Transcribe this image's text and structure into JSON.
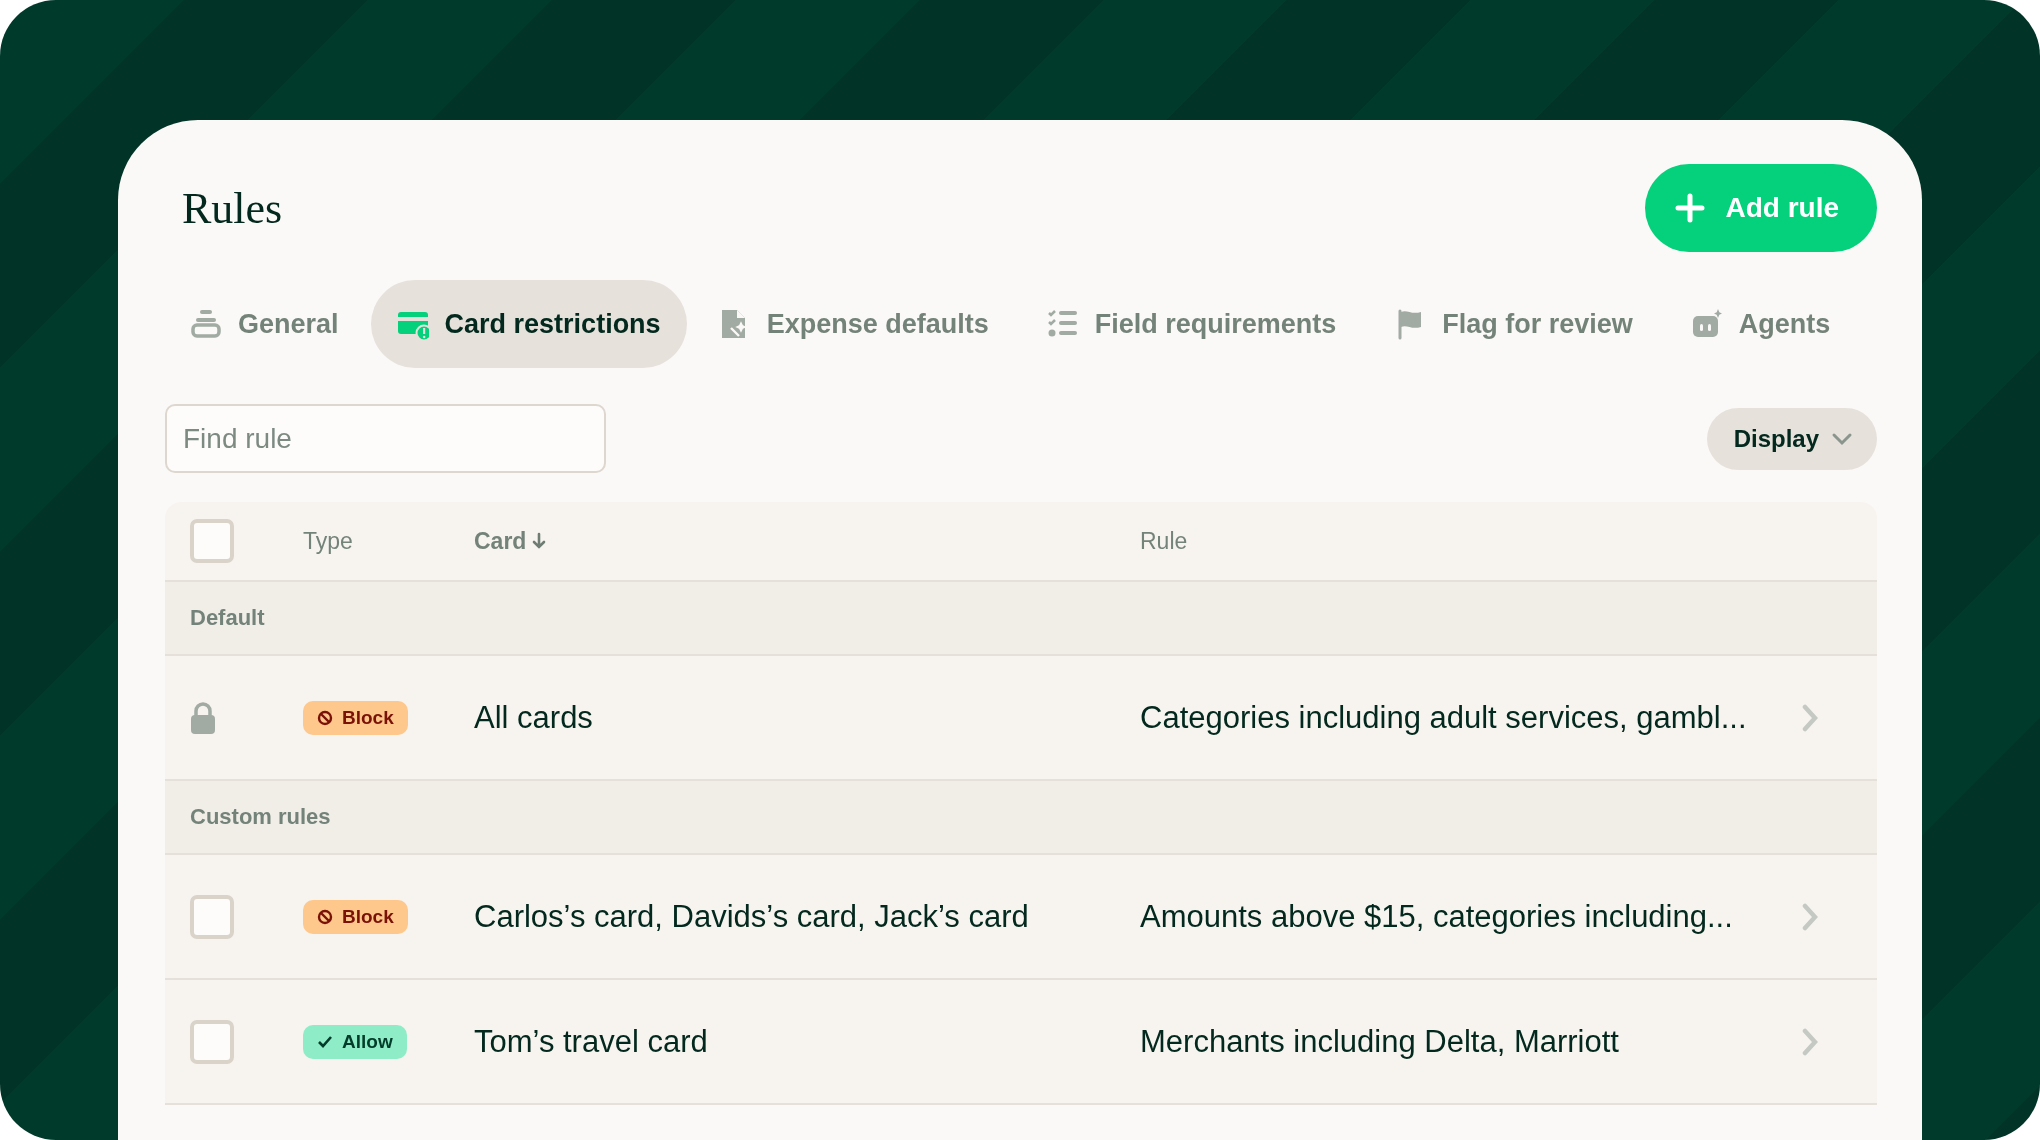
{
  "page": {
    "title": "Rules"
  },
  "add_button": {
    "label": "Add rule"
  },
  "tabs": [
    {
      "label": "General",
      "kind": "general",
      "selected": false
    },
    {
      "label": "Card restrictions",
      "kind": "card",
      "selected": true
    },
    {
      "label": "Expense defaults",
      "kind": "document",
      "selected": false
    },
    {
      "label": "Field requirements",
      "kind": "checklist",
      "selected": false
    },
    {
      "label": "Flag for review",
      "kind": "flag",
      "selected": false
    },
    {
      "label": "Agents",
      "kind": "robot",
      "selected": false
    }
  ],
  "search": {
    "placeholder": "Find rule"
  },
  "display_button": {
    "label": "Display"
  },
  "table": {
    "select_all": {
      "checked": false
    },
    "columns": [
      {
        "label": "Type",
        "sorted": false
      },
      {
        "label": "Card",
        "sorted": true
      },
      {
        "label": "Rule",
        "sorted": false
      }
    ],
    "groups": [
      {
        "label": "Default",
        "rows": [
          {
            "kind": "locked",
            "type": {
              "kind": "block",
              "label": "Block"
            },
            "card": "All cards",
            "rule": "Categories including adult services, gambl..."
          }
        ]
      },
      {
        "label": "Custom rules",
        "rows": [
          {
            "kind": "selectable",
            "checked": false,
            "type": {
              "kind": "block",
              "label": "Block"
            },
            "card": "Carlos’s card, Davids’s card, Jack’s card",
            "rule": "Amounts above $15, categories including..."
          },
          {
            "kind": "selectable",
            "checked": false,
            "type": {
              "kind": "allow",
              "label": "Allow"
            },
            "card": "Tom’s travel card",
            "rule": "Merchants including Delta, Marriott"
          }
        ]
      }
    ]
  }
}
